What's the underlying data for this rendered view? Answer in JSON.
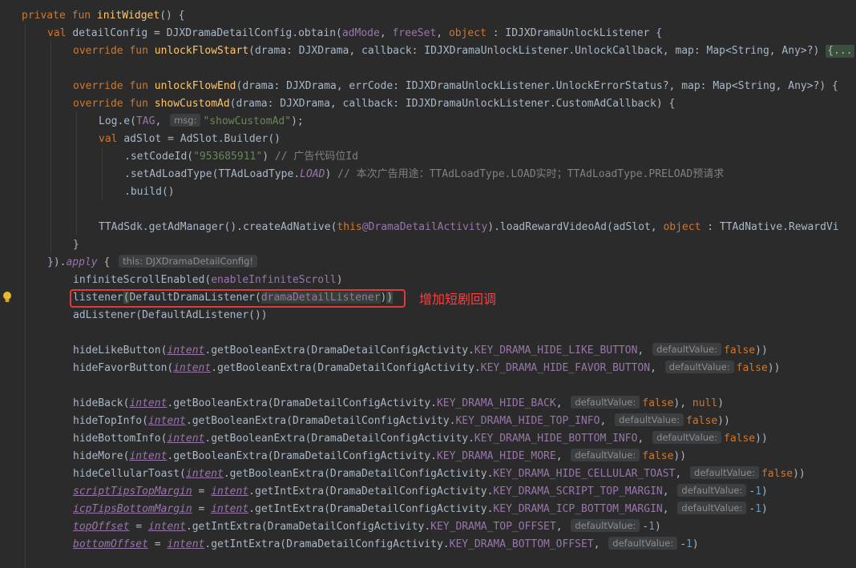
{
  "lines": [
    {
      "id": "l1",
      "t": [
        [
          "k",
          "private fun "
        ],
        [
          "f",
          "initWidget"
        ],
        [
          "lbl",
          "() {"
        ]
      ]
    },
    {
      "id": "l2",
      "t": [
        [
          "k",
          "val "
        ],
        [
          "lbl",
          "detailConfig = DJXDramaDetailConfig.obtain("
        ],
        [
          "p",
          "adMode"
        ],
        [
          "lbl",
          ", "
        ],
        [
          "p",
          "freeSet"
        ],
        [
          "lbl",
          ", "
        ],
        [
          "k",
          "object "
        ],
        [
          "lbl",
          ": IDJXDramaUnlockListener {"
        ]
      ]
    },
    {
      "id": "l3",
      "t": [
        [
          "k",
          "override fun "
        ],
        [
          "f",
          "unlockFlowStart"
        ],
        [
          "lbl",
          "(drama: DJXDrama, callback: IDJXDramaUnlockListener.UnlockCallback, map: Map<String, Any>?) "
        ],
        [
          "fold",
          "{..."
        ]
      ]
    },
    {
      "id": "l4",
      "t": []
    },
    {
      "id": "l5",
      "t": [
        [
          "k",
          "override fun "
        ],
        [
          "f",
          "unlockFlowEnd"
        ],
        [
          "lbl",
          "(drama: DJXDrama, errCode: IDJXDramaUnlockListener.UnlockErrorStatus?, map: Map<String, Any>?) {"
        ]
      ]
    },
    {
      "id": "l6",
      "t": [
        [
          "k",
          "override fun "
        ],
        [
          "f",
          "showCustomAd"
        ],
        [
          "lbl",
          "(drama: DJXDrama, callback: IDJXDramaUnlockListener.CustomAdCallback) {"
        ]
      ]
    },
    {
      "id": "l7",
      "t": [
        [
          "lbl",
          "Log.e("
        ],
        [
          "p",
          "TAG"
        ],
        [
          "lbl",
          ", "
        ],
        [
          "hint",
          "msg:"
        ],
        [
          "s",
          "\"showCustomAd\""
        ],
        [
          "lbl",
          ");"
        ]
      ]
    },
    {
      "id": "l8",
      "t": [
        [
          "k",
          "val "
        ],
        [
          "lbl",
          "adSlot = AdSlot.Builder()"
        ]
      ]
    },
    {
      "id": "l9",
      "t": [
        [
          "lbl",
          ".setCodeId("
        ],
        [
          "s",
          "\"953685911\""
        ],
        [
          "lbl",
          ") "
        ],
        [
          "c",
          "// 广告代码位Id"
        ]
      ]
    },
    {
      "id": "l10",
      "t": [
        [
          "lbl",
          ".setAdLoadType(TTAdLoadType."
        ],
        [
          "ti",
          "LOAD"
        ],
        [
          "lbl",
          ") "
        ],
        [
          "c",
          "// 本次广告用途：TTAdLoadType.LOAD实时；TTAdLoadType.PRELOAD预请求"
        ]
      ]
    },
    {
      "id": "l11",
      "t": [
        [
          "lbl",
          ".build()"
        ]
      ]
    },
    {
      "id": "l12",
      "t": []
    },
    {
      "id": "l13",
      "t": [
        [
          "lbl",
          "TTAdSdk.getAdManager().createAdNative("
        ],
        [
          "k",
          "this"
        ],
        [
          "p",
          "@DramaDetailActivity"
        ],
        [
          "lbl",
          ").loadRewardVideoAd(adSlot, "
        ],
        [
          "k",
          "object "
        ],
        [
          "lbl",
          ": TTAdNative.RewardVi"
        ]
      ]
    },
    {
      "id": "l14",
      "t": [
        [
          "lbl",
          "}"
        ]
      ]
    },
    {
      "id": "l15",
      "t": [
        [
          "lbl",
          "})."
        ],
        [
          "ti",
          "apply"
        ],
        [
          "lbl",
          " { "
        ],
        [
          "hint",
          "this: DJXDramaDetailConfig!"
        ]
      ]
    },
    {
      "id": "l16",
      "t": [
        [
          "lbl",
          "infiniteScrollEnabled("
        ],
        [
          "p",
          "enableInfiniteScroll"
        ],
        [
          "lbl",
          ")"
        ]
      ]
    },
    {
      "id": "l17",
      "t": [
        [
          "lbl",
          "listener"
        ],
        [
          "bm",
          "("
        ],
        [
          "lbl",
          "DefaultDramaListener("
        ],
        [
          "hl",
          "dramaDetailListener"
        ],
        [
          "lbl",
          ")"
        ],
        [
          "bm",
          ")"
        ]
      ]
    },
    {
      "id": "l18",
      "t": [
        [
          "lbl",
          "adListener(DefaultAdListener())"
        ]
      ]
    },
    {
      "id": "l19",
      "t": []
    },
    {
      "id": "l20",
      "t": [
        [
          "lbl",
          "hideLikeButton("
        ],
        [
          "pu",
          "intent"
        ],
        [
          "lbl",
          ".getBooleanExtra(DramaDetailConfigActivity."
        ],
        [
          "p",
          "KEY_DRAMA_HIDE_LIKE_BUTTON"
        ],
        [
          "lbl",
          ", "
        ],
        [
          "hint",
          "defaultValue:"
        ],
        [
          "k",
          "false"
        ],
        [
          "lbl",
          "))"
        ]
      ]
    },
    {
      "id": "l21",
      "t": [
        [
          "lbl",
          "hideFavorButton("
        ],
        [
          "pu",
          "intent"
        ],
        [
          "lbl",
          ".getBooleanExtra(DramaDetailConfigActivity."
        ],
        [
          "p",
          "KEY_DRAMA_HIDE_FAVOR_BUTTON"
        ],
        [
          "lbl",
          ", "
        ],
        [
          "hint",
          "defaultValue:"
        ],
        [
          "k",
          "false"
        ],
        [
          "lbl",
          "))"
        ]
      ]
    },
    {
      "id": "l22",
      "t": []
    },
    {
      "id": "l23",
      "t": [
        [
          "lbl",
          "hideBack("
        ],
        [
          "pu",
          "intent"
        ],
        [
          "lbl",
          ".getBooleanExtra(DramaDetailConfigActivity."
        ],
        [
          "p",
          "KEY_DRAMA_HIDE_BACK"
        ],
        [
          "lbl",
          ", "
        ],
        [
          "hint",
          "defaultValue:"
        ],
        [
          "k",
          "false"
        ],
        [
          "lbl",
          "), "
        ],
        [
          "k",
          "null"
        ],
        [
          "lbl",
          ")"
        ]
      ]
    },
    {
      "id": "l24",
      "t": [
        [
          "lbl",
          "hideTopInfo("
        ],
        [
          "pu",
          "intent"
        ],
        [
          "lbl",
          ".getBooleanExtra(DramaDetailConfigActivity."
        ],
        [
          "p",
          "KEY_DRAMA_HIDE_TOP_INFO"
        ],
        [
          "lbl",
          ", "
        ],
        [
          "hint",
          "defaultValue:"
        ],
        [
          "k",
          "false"
        ],
        [
          "lbl",
          "))"
        ]
      ]
    },
    {
      "id": "l25",
      "t": [
        [
          "lbl",
          "hideBottomInfo("
        ],
        [
          "pu",
          "intent"
        ],
        [
          "lbl",
          ".getBooleanExtra(DramaDetailConfigActivity."
        ],
        [
          "p",
          "KEY_DRAMA_HIDE_BOTTOM_INFO"
        ],
        [
          "lbl",
          ", "
        ],
        [
          "hint",
          "defaultValue:"
        ],
        [
          "k",
          "false"
        ],
        [
          "lbl",
          "))"
        ]
      ]
    },
    {
      "id": "l26",
      "t": [
        [
          "lbl",
          "hideMore("
        ],
        [
          "pu",
          "intent"
        ],
        [
          "lbl",
          ".getBooleanExtra(DramaDetailConfigActivity."
        ],
        [
          "p",
          "KEY_DRAMA_HIDE_MORE"
        ],
        [
          "lbl",
          ", "
        ],
        [
          "hint",
          "defaultValue:"
        ],
        [
          "k",
          "false"
        ],
        [
          "lbl",
          "))"
        ]
      ]
    },
    {
      "id": "l27",
      "t": [
        [
          "lbl",
          "hideCellularToast("
        ],
        [
          "pu",
          "intent"
        ],
        [
          "lbl",
          ".getBooleanExtra(DramaDetailConfigActivity."
        ],
        [
          "p",
          "KEY_DRAMA_HIDE_CELLULAR_TOAST"
        ],
        [
          "lbl",
          ", "
        ],
        [
          "hint",
          "defaultValue:"
        ],
        [
          "k",
          "false"
        ],
        [
          "lbl",
          "))"
        ]
      ]
    },
    {
      "id": "l28",
      "t": [
        [
          "pu",
          "scriptTipsTopMargin"
        ],
        [
          "lbl",
          " = "
        ],
        [
          "pu",
          "intent"
        ],
        [
          "lbl",
          ".getIntExtra(DramaDetailConfigActivity."
        ],
        [
          "p",
          "KEY_DRAMA_SCRIPT_TOP_MARGIN"
        ],
        [
          "lbl",
          ", "
        ],
        [
          "hint",
          "defaultValue:"
        ],
        [
          "lbl",
          "-"
        ],
        [
          "n",
          "1"
        ],
        [
          "lbl",
          ")"
        ]
      ]
    },
    {
      "id": "l29",
      "t": [
        [
          "pu",
          "icpTipsBottomMargin"
        ],
        [
          "lbl",
          " = "
        ],
        [
          "pu",
          "intent"
        ],
        [
          "lbl",
          ".getIntExtra(DramaDetailConfigActivity."
        ],
        [
          "p",
          "KEY_DRAMA_ICP_BOTTOM_MARGIN"
        ],
        [
          "lbl",
          ", "
        ],
        [
          "hint",
          "defaultValue:"
        ],
        [
          "lbl",
          "-"
        ],
        [
          "n",
          "1"
        ],
        [
          "lbl",
          ")"
        ]
      ]
    },
    {
      "id": "l30",
      "t": [
        [
          "pu",
          "topOffset"
        ],
        [
          "lbl",
          " = "
        ],
        [
          "pu",
          "intent"
        ],
        [
          "lbl",
          ".getIntExtra(DramaDetailConfigActivity."
        ],
        [
          "p",
          "KEY_DRAMA_TOP_OFFSET"
        ],
        [
          "lbl",
          ", "
        ],
        [
          "hint",
          "defaultValue:"
        ],
        [
          "lbl",
          "-"
        ],
        [
          "n",
          "1"
        ],
        [
          "lbl",
          ")"
        ]
      ]
    },
    {
      "id": "l31",
      "t": [
        [
          "pu",
          "bottomOffset"
        ],
        [
          "lbl",
          " = "
        ],
        [
          "pu",
          "intent"
        ],
        [
          "lbl",
          ".getIntExtra(DramaDetailConfigActivity."
        ],
        [
          "p",
          "KEY_DRAMA_BOTTOM_OFFSET"
        ],
        [
          "lbl",
          ", "
        ],
        [
          "hint",
          "defaultValue:"
        ],
        [
          "lbl",
          "-"
        ],
        [
          "n",
          "1"
        ],
        [
          "lbl",
          ")"
        ]
      ]
    }
  ],
  "annotation": "增加短剧回调",
  "colors": {
    "keyword": "#cc7832",
    "function": "#ffc66d",
    "string": "#6a8759",
    "comment": "#808080",
    "property": "#9876aa",
    "number": "#6897bb",
    "annotation_red": "#ff3d3d"
  }
}
